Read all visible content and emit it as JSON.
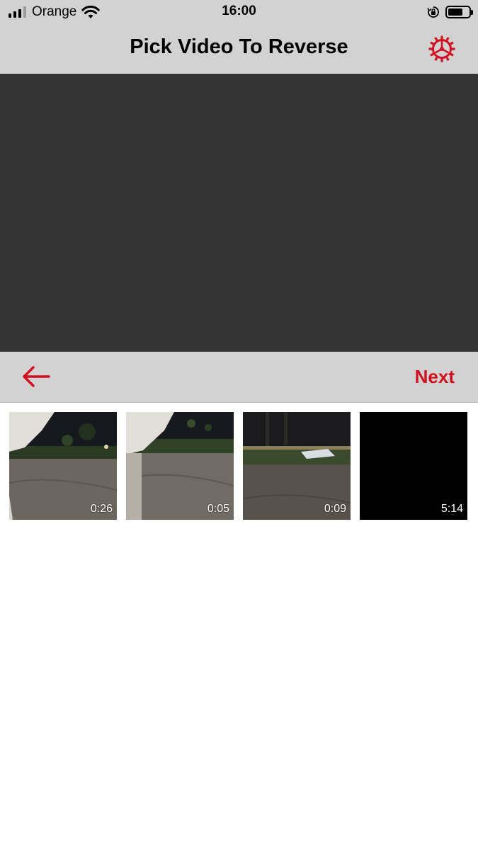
{
  "status_bar": {
    "carrier": "Orange",
    "time": "16:00",
    "signal_bars": 4,
    "signal_active_bars": 3,
    "battery_level": 0.7,
    "icons": [
      "signal-icon",
      "wifi-icon",
      "orientation-lock-icon",
      "battery-icon"
    ]
  },
  "nav": {
    "title": "Pick Video To Reverse",
    "settings_icon": "gear-icon"
  },
  "toolbar": {
    "back_icon": "back-arrow-icon",
    "next_label": "Next"
  },
  "videos": [
    {
      "duration": "0:26"
    },
    {
      "duration": "0:05"
    },
    {
      "duration": "0:09"
    },
    {
      "duration": "5:14"
    }
  ],
  "colors": {
    "accent": "#d0101e",
    "bar_background": "#d2d2d2",
    "preview_background": "#333333"
  }
}
